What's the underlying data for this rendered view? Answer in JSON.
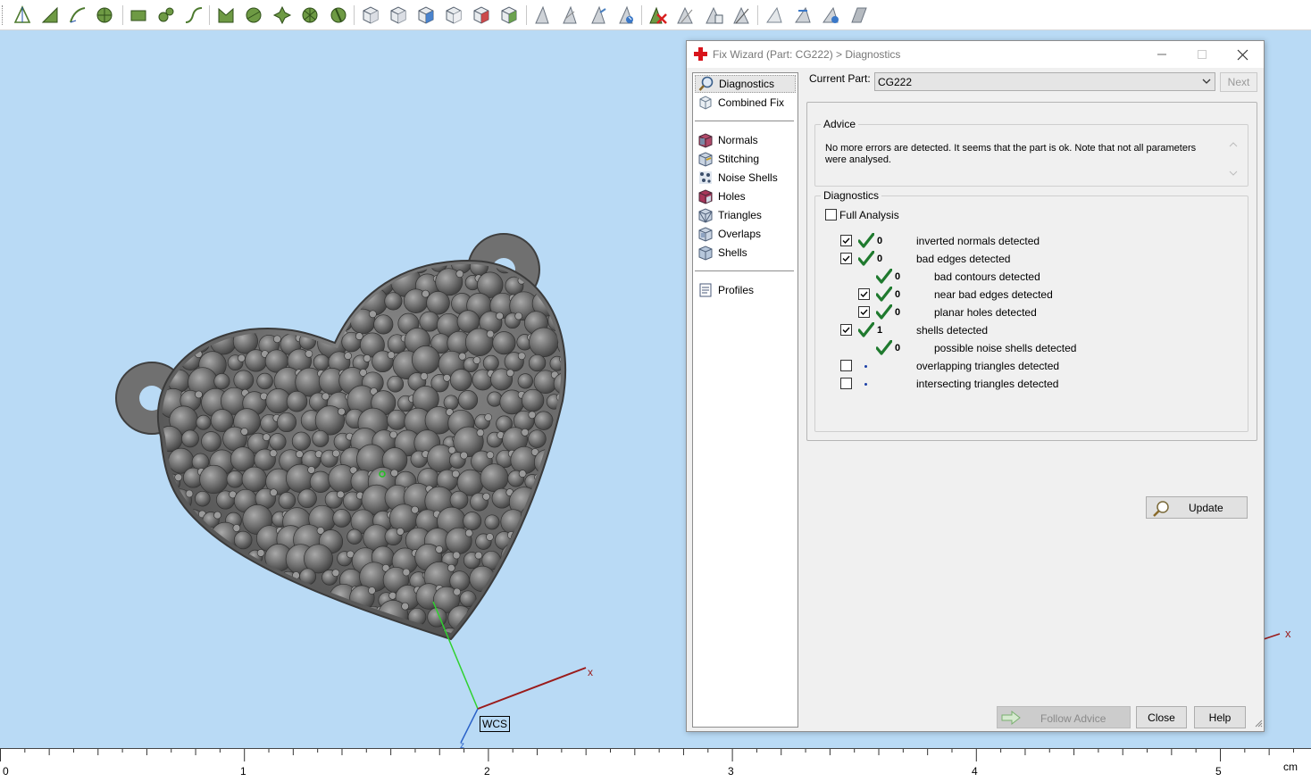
{
  "toolbar": {
    "icons": [
      "mark-triangle-icon",
      "mark-surface-icon",
      "mark-shell-icon",
      "mark-plane-icon",
      "mark-box-icon",
      "mark-sphere-icon",
      "mark-curve-icon",
      "mark-connected-icon",
      "mark-angle-icon",
      "mark-wave-icon",
      "mark-radius-icon",
      "mark-brush-icon",
      "view-front-icon",
      "view-side-icon",
      "view-top-icon",
      "view-wire-icon",
      "view-shaded-icon",
      "view-iso-icon",
      "triangle-select-icon",
      "triangle-flat-icon",
      "triangle-edge-icon",
      "triangle-normal-icon",
      "delete-triangle-icon",
      "triangle-fill-icon",
      "triangle-copy-icon",
      "triangle-plane-icon",
      "cut-icon",
      "measure-icon",
      "mirror-icon",
      "grid-icon"
    ]
  },
  "viewport": {
    "axis_x_label": "x",
    "axis_z_label": "z",
    "wcs_label": "WCS",
    "far_x_label": "x"
  },
  "ruler": {
    "ticks": [
      "0",
      "1",
      "2",
      "3",
      "4",
      "5"
    ],
    "unit": "cm"
  },
  "dialog": {
    "title": "Fix Wizard (Part: CG222) > Diagnostics",
    "nav": {
      "items_top": [
        {
          "label": "Diagnostics",
          "icon": "magnifier-icon",
          "selected": true
        },
        {
          "label": "Combined Fix",
          "icon": "cube-gear-icon",
          "selected": false
        }
      ],
      "items_mid": [
        {
          "label": "Normals",
          "icon": "normals-cube-icon"
        },
        {
          "label": "Stitching",
          "icon": "stitching-cube-icon"
        },
        {
          "label": "Noise Shells",
          "icon": "noise-shells-icon"
        },
        {
          "label": "Holes",
          "icon": "holes-cube-icon"
        },
        {
          "label": "Triangles",
          "icon": "triangles-cube-icon"
        },
        {
          "label": "Overlaps",
          "icon": "overlaps-cube-icon"
        },
        {
          "label": "Shells",
          "icon": "shells-cube-icon"
        }
      ],
      "items_bottom": [
        {
          "label": "Profiles",
          "icon": "document-icon"
        }
      ]
    },
    "current_part_label": "Current Part:",
    "current_part_value": "CG222",
    "next_label": "Next",
    "advice_legend": "Advice",
    "advice_text": "No more errors are detected. It seems that the part is ok. Note that not all parameters were analysed.",
    "diagnostics_legend": "Diagnostics",
    "full_analysis_label": "Full Analysis",
    "full_analysis_checked": false,
    "rows": [
      {
        "checkbox": true,
        "checked": true,
        "status": "ok",
        "count": "0",
        "text": "inverted normals detected",
        "indent": 0
      },
      {
        "checkbox": true,
        "checked": true,
        "status": "ok",
        "count": "0",
        "text": "bad edges detected",
        "indent": 0
      },
      {
        "checkbox": false,
        "checked": false,
        "status": "ok",
        "count": "0",
        "text": "bad contours detected",
        "indent": 1
      },
      {
        "checkbox": true,
        "checked": true,
        "status": "ok",
        "count": "0",
        "text": "near bad edges detected",
        "indent": 1
      },
      {
        "checkbox": true,
        "checked": true,
        "status": "ok",
        "count": "0",
        "text": "planar holes detected",
        "indent": 1
      },
      {
        "checkbox": true,
        "checked": true,
        "status": "ok",
        "count": "1",
        "text": "shells detected",
        "indent": 0
      },
      {
        "checkbox": false,
        "checked": false,
        "status": "ok",
        "count": "0",
        "text": "possible noise shells detected",
        "indent": 1
      },
      {
        "checkbox": true,
        "checked": false,
        "status": "none",
        "count": "",
        "text": "overlapping triangles detected",
        "indent": 0
      },
      {
        "checkbox": true,
        "checked": false,
        "status": "none",
        "count": "",
        "text": "intersecting triangles detected",
        "indent": 0
      }
    ],
    "update_label": "Update",
    "follow_advice_label": "Follow Advice",
    "close_label": "Close",
    "help_label": "Help"
  },
  "colors": {
    "viewport_bg": "#b9daf5",
    "check_green": "#1f7a2e",
    "axis_x": "#9a1b1b",
    "axis_y": "#1fbf1f",
    "axis_z": "#2b62c8",
    "toolbar_icon": "#5d8a3c",
    "title_icon_red": "#d8141b"
  }
}
